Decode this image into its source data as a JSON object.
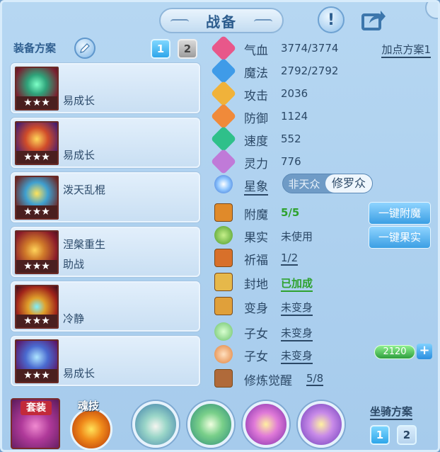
{
  "title": "战备",
  "left": {
    "header": "装备方案",
    "plan_tabs": [
      "1",
      "2"
    ],
    "cards": [
      {
        "top_label": "",
        "bottom_label": "易成长"
      },
      {
        "top_label": "",
        "bottom_label": "易成长"
      },
      {
        "top_label": "泼天乱棍",
        "bottom_label": ""
      },
      {
        "top_label": "涅槃重生",
        "bottom_label": "助战"
      },
      {
        "top_label": "",
        "bottom_label": "冷静"
      },
      {
        "top_label": "",
        "bottom_label": "易成长"
      }
    ],
    "stars": "★★★"
  },
  "right": {
    "add_point_plan": "加点方案1",
    "stats": [
      {
        "label": "气血",
        "value": "3774/3774",
        "color": "#e8578a"
      },
      {
        "label": "魔法",
        "value": "2792/2792",
        "color": "#3f9be8"
      },
      {
        "label": "攻击",
        "value": "2036",
        "color": "#f0b23a"
      },
      {
        "label": "防御",
        "value": "1124",
        "color": "#f08a3a"
      },
      {
        "label": "速度",
        "value": "552",
        "color": "#2fc08a"
      },
      {
        "label": "灵力",
        "value": "776",
        "color": "#c07ad8"
      }
    ],
    "star_sign": {
      "label": "星象",
      "option_a": "非天众",
      "option_b": "修罗众"
    },
    "extras": [
      {
        "label": "附魔",
        "value": "5/5"
      },
      {
        "label": "果实",
        "value": "未使用"
      },
      {
        "label": "祈福",
        "value": "1/2"
      },
      {
        "label": "封地",
        "value": "已加成"
      },
      {
        "label": "变身",
        "value": "未变身"
      },
      {
        "label": "子女",
        "value": "未变身"
      },
      {
        "label": "子女",
        "value": "未变身"
      },
      {
        "label": "修炼觉醒",
        "value": "5/8"
      }
    ],
    "btn_enchant": "一键附魔",
    "btn_fruit": "一键果实",
    "progress_value": "2120",
    "plus": "+"
  },
  "bottom": {
    "suit_label": "套装",
    "skill_label": "魂技",
    "mount_label": "坐骑方案",
    "mount_tabs": [
      "1",
      "2"
    ]
  }
}
